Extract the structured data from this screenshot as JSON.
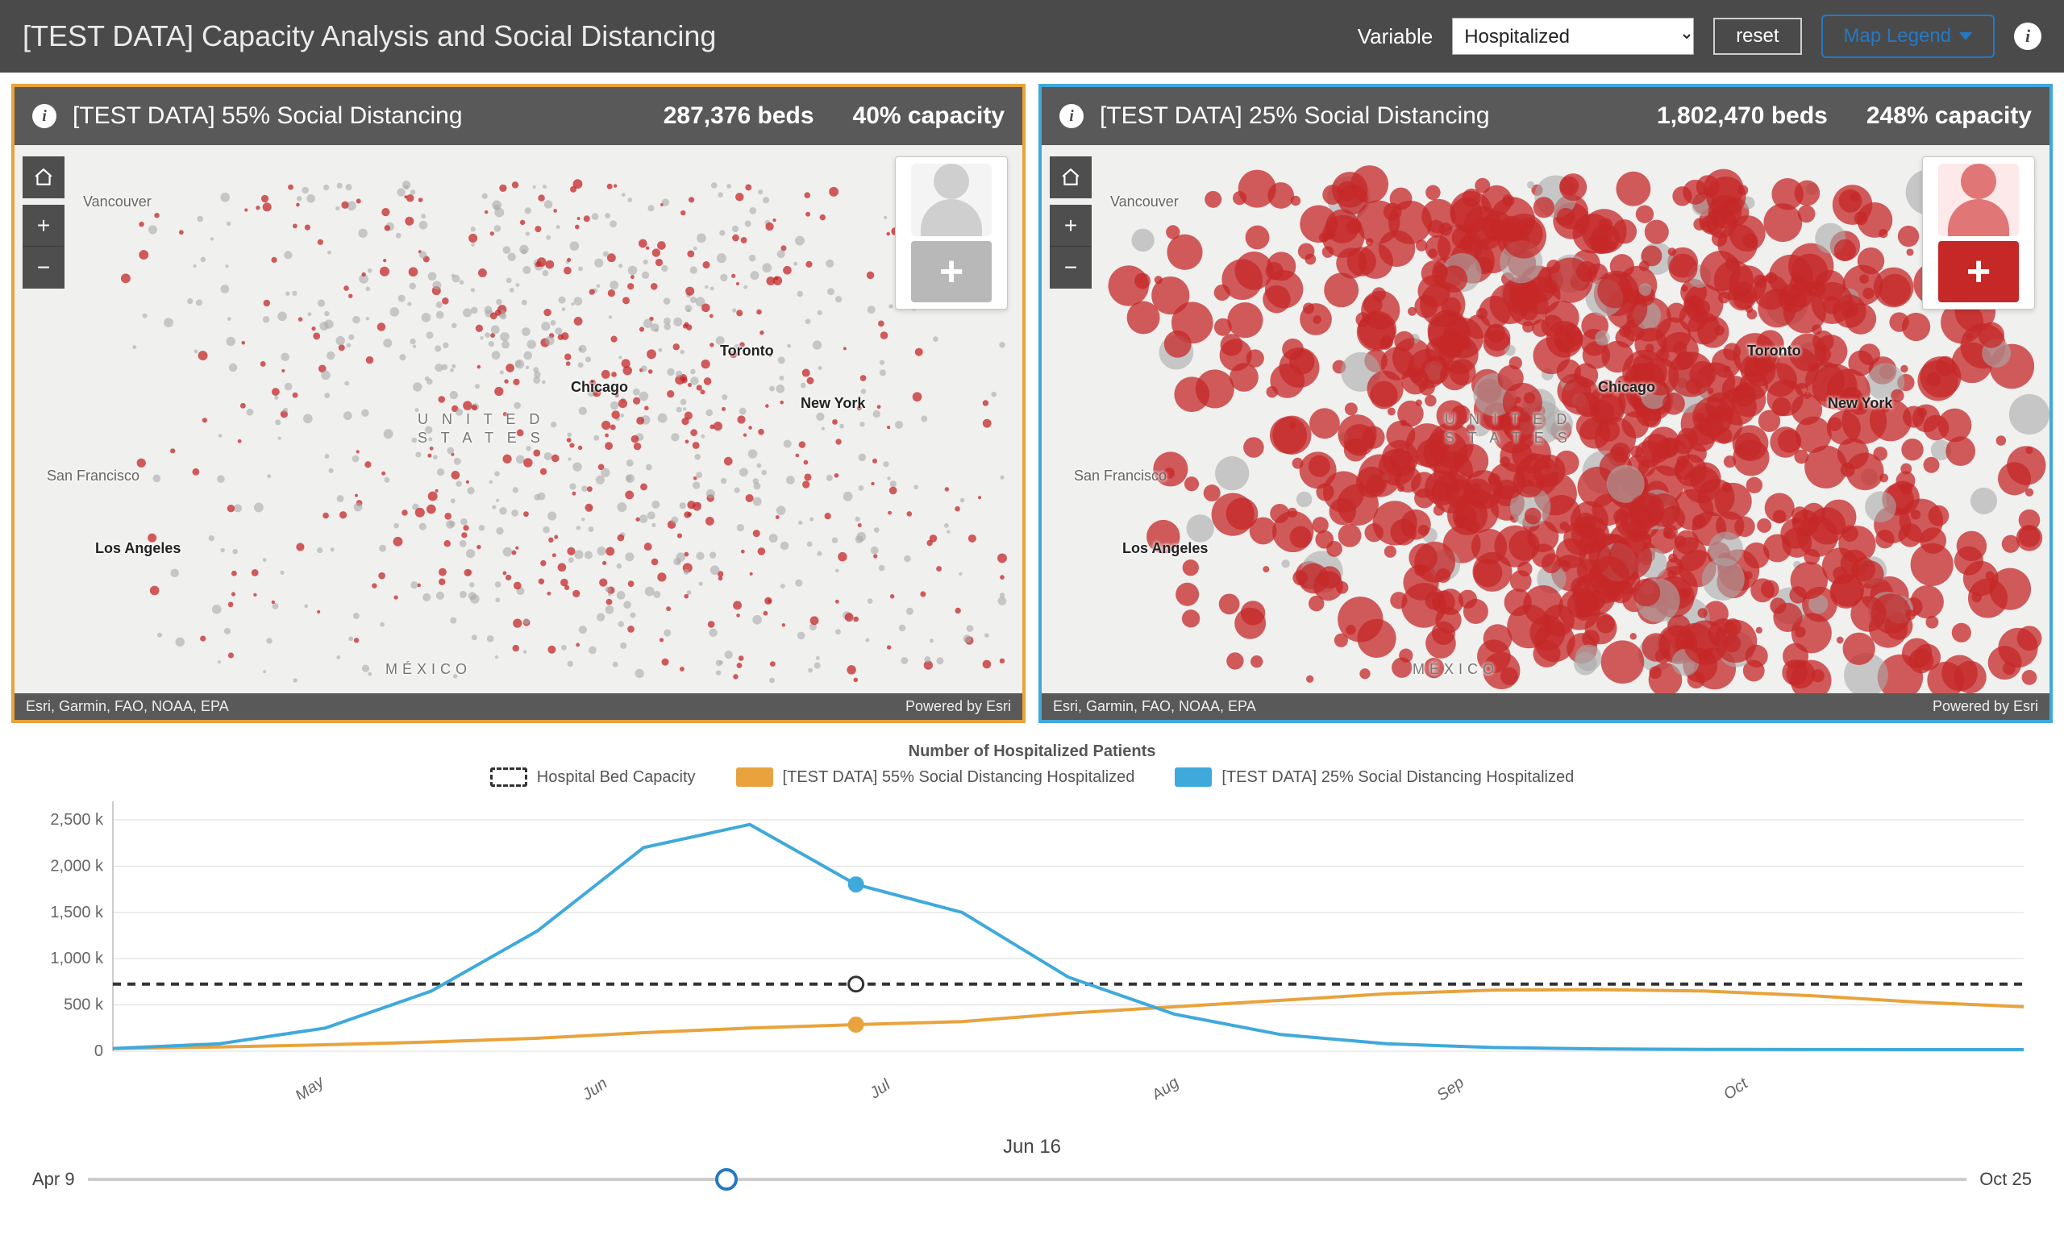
{
  "header": {
    "title": "[TEST DATA] Capacity Analysis and Social Distancing",
    "variable_label": "Variable",
    "variable_value": "Hospitalized",
    "reset_label": "reset",
    "map_legend_label": "Map Legend"
  },
  "maps": {
    "left": {
      "title": "[TEST DATA] 55% Social Distancing",
      "beds": "287,376 beds",
      "capacity": "40% capacity",
      "border_color": "#e8a33d",
      "hospital_status": "normal"
    },
    "right": {
      "title": "[TEST DATA] 25% Social Distancing",
      "beds": "1,802,470 beds",
      "capacity": "248% capacity",
      "border_color": "#3fa9db",
      "hospital_status": "overloaded"
    },
    "common_labels": {
      "country1_a": "U N I T E D",
      "country1_b": "S T A T E S",
      "country2": "MÉXICO",
      "cities": [
        "Vancouver",
        "San Francisco",
        "Los Angeles",
        "Chicago",
        "Toronto",
        "New York"
      ]
    },
    "footer_left": "Esri, Garmin, FAO, NOAA, EPA",
    "footer_right": "Powered by Esri"
  },
  "chart_data": {
    "type": "line",
    "title": "Number of Hospitalized Patients",
    "ylabel": "",
    "y_ticks": [
      0,
      500,
      1000,
      1500,
      2000,
      2500
    ],
    "y_tick_labels": [
      "0",
      "500 k",
      "1,000 k",
      "1,500 k",
      "2,000 k",
      "2,500 k"
    ],
    "ylim": [
      0,
      2700
    ],
    "x_tick_labels": [
      "May",
      "Jun",
      "Jul",
      "Aug",
      "Sep",
      "Oct"
    ],
    "x": [
      "Apr 9",
      "Apr 20",
      "May 1",
      "May 10",
      "May 20",
      "Jun 1",
      "Jun 10",
      "Jun 16",
      "Jun 20",
      "Jul 1",
      "Jul 10",
      "Jul 20",
      "Aug 1",
      "Aug 15",
      "Sep 1",
      "Sep 15",
      "Oct 1",
      "Oct 15",
      "Oct 25"
    ],
    "series": [
      {
        "name": "Hospital Bed Capacity",
        "style": "dashed",
        "color": "#333333",
        "values": [
          725,
          725,
          725,
          725,
          725,
          725,
          725,
          725,
          725,
          725,
          725,
          725,
          725,
          725,
          725,
          725,
          725,
          725,
          725
        ]
      },
      {
        "name": "[TEST DATA] 55% Social Distancing Hospitalized",
        "style": "solid",
        "color": "#e8a33d",
        "values": [
          30,
          45,
          70,
          100,
          140,
          200,
          250,
          287,
          320,
          410,
          480,
          550,
          620,
          660,
          665,
          650,
          600,
          530,
          480
        ]
      },
      {
        "name": "[TEST DATA] 25% Social Distancing Hospitalized",
        "style": "solid",
        "color": "#3fa9db",
        "values": [
          30,
          80,
          250,
          650,
          1300,
          2200,
          2450,
          1802,
          1500,
          800,
          400,
          180,
          80,
          40,
          25,
          20,
          18,
          17,
          17
        ]
      }
    ],
    "legend": [
      "Hospital Bed Capacity",
      "[TEST DATA] 55% Social Distancing Hospitalized",
      "[TEST DATA] 25% Social Distancing Hospitalized"
    ],
    "current_marker": {
      "x": "Jun 16",
      "capacity": 725,
      "orange": 287,
      "blue": 1802
    }
  },
  "timeline": {
    "start": "Apr 9",
    "end": "Oct 25",
    "current": "Jun 16",
    "position_pct": 34
  }
}
